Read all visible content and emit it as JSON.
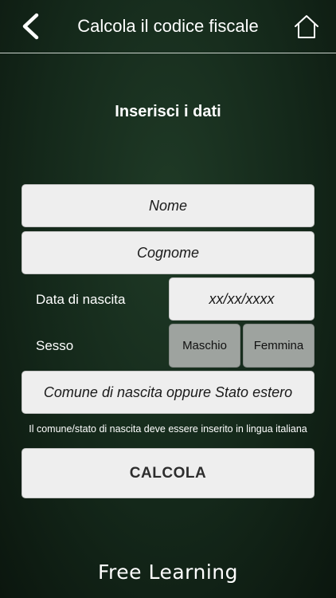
{
  "header": {
    "title": "Calcola il codice fiscale",
    "back_icon": "chevron-left-icon",
    "home_icon": "home-icon"
  },
  "form": {
    "section_title": "Inserisci i dati",
    "nome_placeholder": "Nome",
    "cognome_placeholder": "Cognome",
    "birth_date_label": "Data di nascita",
    "birth_date_placeholder": "xx/xx/xxxx",
    "sex_label": "Sesso",
    "male_label": "Maschio",
    "female_label": "Femmina",
    "birthplace_placeholder": "Comune di nascita oppure Stato estero",
    "birthplace_note": "Il comune/stato di nascita deve essere inserito in lingua italiana",
    "calculate_label": "CALCOLA"
  },
  "footer": {
    "logo_text": "Free Learning"
  },
  "colors": {
    "background": "#14281a",
    "field": "#eeeeee",
    "gender_button": "#9ea39f"
  }
}
